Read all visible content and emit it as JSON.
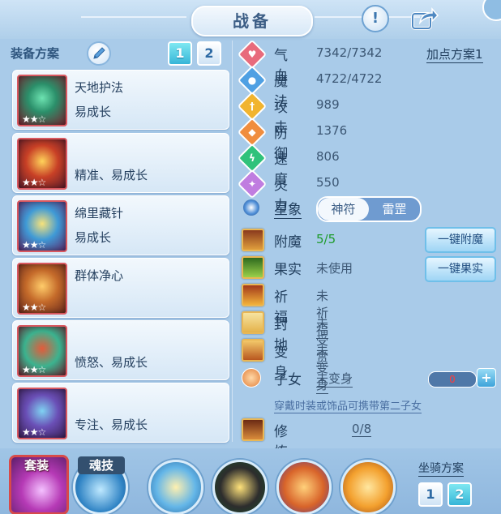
{
  "header": {
    "title": "战备",
    "help_label": "!"
  },
  "left": {
    "section_title": "装备方案",
    "tabs": [
      "1",
      "2"
    ],
    "skills": [
      {
        "name": "天地护法",
        "desc": "易成长",
        "stars": "★★☆"
      },
      {
        "name": "",
        "desc": "精准、易成长",
        "stars": "★★☆"
      },
      {
        "name": "绵里藏针",
        "desc": "易成长",
        "stars": "★★☆"
      },
      {
        "name": "群体净心",
        "desc": "",
        "stars": "★★☆"
      },
      {
        "name": "",
        "desc": "愤怒、易成长",
        "stars": "★★☆"
      },
      {
        "name": "",
        "desc": "专注、易成长",
        "stars": "★★☆"
      }
    ]
  },
  "stats": {
    "addpoint_label": "加点方案1",
    "items": [
      {
        "label": "气血",
        "value": "7342/7342",
        "color": "#e86b7c",
        "icon": "heart-icon",
        "glyph": "♥"
      },
      {
        "label": "魔法",
        "value": "4722/4722",
        "color": "#4fa0e3",
        "icon": "mana-icon",
        "glyph": "●"
      },
      {
        "label": "攻击",
        "value": "989",
        "color": "#f1b42f",
        "icon": "sword-icon",
        "glyph": "†"
      },
      {
        "label": "防御",
        "value": "1376",
        "color": "#f08d3e",
        "icon": "shield-icon",
        "glyph": "◆"
      },
      {
        "label": "速度",
        "value": "806",
        "color": "#2fc27b",
        "icon": "lightning-icon",
        "glyph": "ϟ"
      },
      {
        "label": "灵力",
        "value": "550",
        "color": "#c07de0",
        "icon": "spirit-icon",
        "glyph": "✦"
      }
    ]
  },
  "star_sign": {
    "label": "星象",
    "options": [
      "神符",
      "雷罡"
    ]
  },
  "mods": {
    "enchant": {
      "label": "附魔",
      "value": "5/5",
      "button": "一键附魔"
    },
    "fruit": {
      "label": "果实",
      "value": "未使用",
      "button": "一键果实"
    },
    "blessing": {
      "label": "祈福",
      "value": "未祈福"
    },
    "fief": {
      "label": "封地",
      "value": "未受赏"
    },
    "transform": {
      "label": "变身",
      "value": "未变身"
    },
    "children": {
      "label": "子女",
      "value": "未变身",
      "count": "0",
      "plus": "+"
    },
    "note": "穿戴时装或饰品可携带第二子女",
    "awaken": {
      "label": "修炼觉醒",
      "value": "0/8"
    }
  },
  "bottom": {
    "suit_label": "套装",
    "soul_label": "魂技",
    "mount_label": "坐骑方案",
    "mount_tabs": [
      "1",
      "2"
    ]
  }
}
